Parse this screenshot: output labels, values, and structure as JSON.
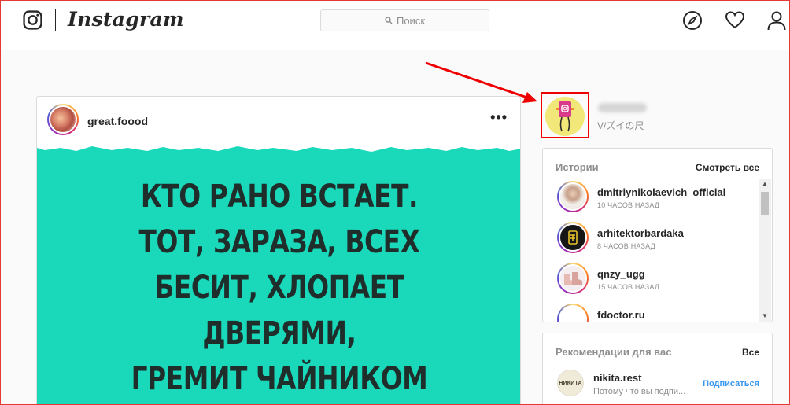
{
  "app": {
    "wordmark": "Instagram",
    "search_placeholder": "Поиск"
  },
  "nav_icons": [
    "explore-compass-icon",
    "activity-heart-icon",
    "profile-person-icon"
  ],
  "post": {
    "username": "great.foood",
    "more": "•••",
    "image_lines": [
      "КТО РАНО ВСТАЕТ.",
      "ТОТ, ЗАРАЗА, ВСЕХ",
      "БЕСИТ, ХЛОПАЕТ",
      "ДВЕРЯМИ,",
      "ГРЕМИТ ЧАЙНИКОМ"
    ],
    "image_bg": "#19d9ba"
  },
  "me": {
    "full_name": "V/ズイの尺"
  },
  "stories": {
    "title": "Истории",
    "see_all": "Смотреть все",
    "items": [
      {
        "name": "dmitriynikolaevich_official",
        "time": "10 ЧАСОВ НАЗАД"
      },
      {
        "name": "arhitektorbardaka",
        "time": "8 ЧАСОВ НАЗАД"
      },
      {
        "name": "qnzy_ugg",
        "time": "15 ЧАСОВ НАЗАД"
      },
      {
        "name": "fdoctor.ru",
        "time": ""
      }
    ]
  },
  "recommendations": {
    "title": "Рекомендации для вас",
    "all": "Все",
    "items": [
      {
        "name": "nikita.rest",
        "subtitle": "Потому что вы подпи...",
        "action": "Подписаться",
        "avatar_text": "НИКИТА"
      }
    ]
  },
  "colors": {
    "accent": "#3897f0",
    "annotation": "#e00000"
  }
}
